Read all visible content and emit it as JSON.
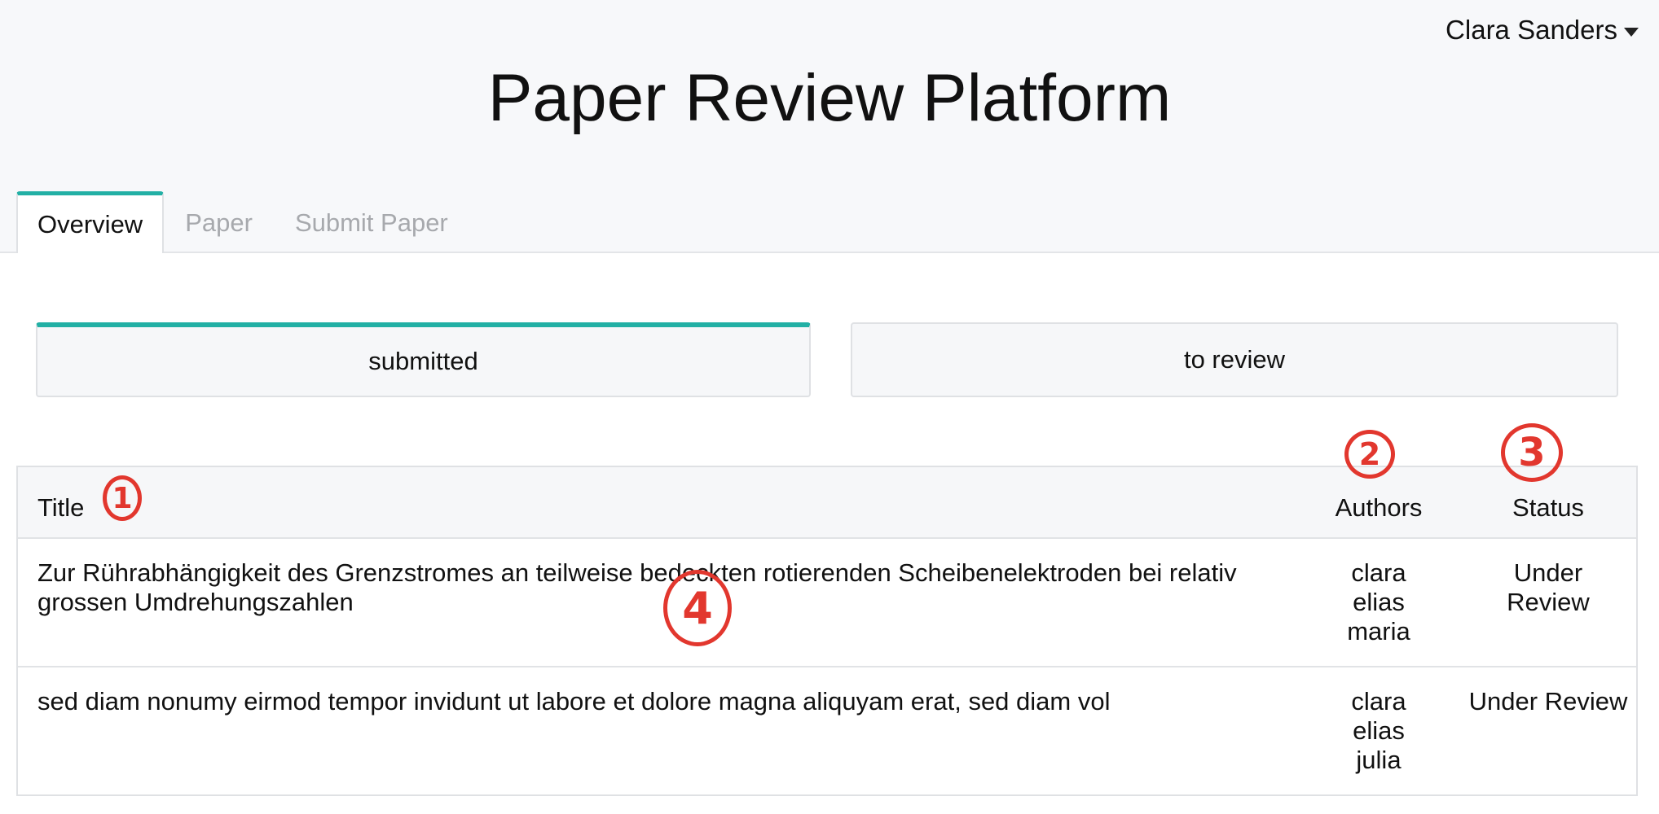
{
  "header": {
    "user_name": "Clara Sanders",
    "title": "Paper Review Platform",
    "tabs": [
      {
        "label": "Overview",
        "active": true
      },
      {
        "label": "Paper",
        "active": false
      },
      {
        "label": "Submit Paper",
        "active": false
      }
    ]
  },
  "toggle": {
    "submitted": "submitted",
    "to_review": "to review",
    "active": "submitted"
  },
  "table": {
    "columns": {
      "title": "Title",
      "authors": "Authors",
      "status": "Status"
    },
    "rows": [
      {
        "title": "Zur Rührabhängigkeit des Grenzstromes an teilweise bedeckten rotierenden Scheibenelektroden bei relativ grossen Umdrehungszahlen",
        "authors": [
          "clara",
          "elias",
          "maria"
        ],
        "status": "Under Review"
      },
      {
        "title": "sed diam nonumy eirmod tempor invidunt ut labore et dolore magna aliquyam erat, sed diam vol",
        "authors": [
          "clara",
          "elias",
          "julia"
        ],
        "status": "Under Review"
      }
    ]
  },
  "annotations": [
    "1",
    "2",
    "3",
    "4"
  ],
  "colors": {
    "accent": "#22b0a5",
    "annotation": "#e2372e",
    "header_bg": "#f7f8fa"
  }
}
